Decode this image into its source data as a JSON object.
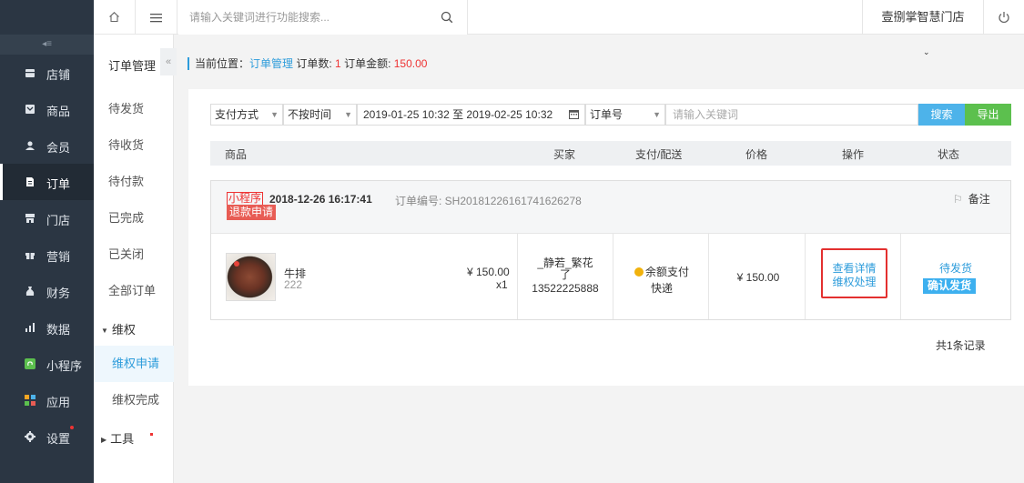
{
  "topbar": {
    "search_placeholder": "请输入关键词进行功能搜索...",
    "store_name": "壹捌掌智慧门店"
  },
  "main_nav": {
    "items": [
      {
        "label": "店铺",
        "icon": "store-icon"
      },
      {
        "label": "商品",
        "icon": "goods-icon"
      },
      {
        "label": "会员",
        "icon": "member-icon"
      },
      {
        "label": "订单",
        "icon": "order-icon",
        "active": true
      },
      {
        "label": "门店",
        "icon": "shop-icon"
      },
      {
        "label": "营销",
        "icon": "gift-icon"
      },
      {
        "label": "财务",
        "icon": "finance-icon"
      },
      {
        "label": "数据",
        "icon": "chart-icon"
      },
      {
        "label": "小程序",
        "icon": "miniprogram-icon"
      },
      {
        "label": "应用",
        "icon": "apps-icon"
      },
      {
        "label": "设置",
        "icon": "gear-icon"
      }
    ]
  },
  "sub_nav": {
    "title": "订单管理",
    "items": [
      "待发货",
      "待收货",
      "待付款",
      "已完成",
      "已关闭",
      "全部订单"
    ],
    "group_label": "维权",
    "group_items": [
      "维权申请",
      "维权完成"
    ],
    "tools_label": "工具"
  },
  "breadcrumb": {
    "prefix": "当前位置：",
    "link": "订单管理",
    "count_label": "订单数: ",
    "count": "1",
    "amount_label": "订单金额: ",
    "amount": "150.00"
  },
  "filters": {
    "pay_method": "支付方式",
    "time_filter": "不按时间",
    "date_range": "2019-01-25 10:32 至 2019-02-25 10:32",
    "field": "订单号",
    "keyword_placeholder": "请输入关键词",
    "search_label": "搜索",
    "export_label": "导出"
  },
  "table": {
    "headers": [
      "商品",
      "买家",
      "支付/配送",
      "价格",
      "操作",
      "状态"
    ]
  },
  "order": {
    "source_tag": "小程序",
    "refund_tag": "退款申请",
    "datetime": "2018-12-26  16:17:41",
    "order_no": "订单编号: SH20181226161741626278",
    "remark_label": "备注",
    "product_name": "牛排",
    "product_spec": "222",
    "unit_price": "¥ 150.00",
    "qty": "x1",
    "buyer_name": "_静若_繁花了",
    "buyer_phone": "13522225888",
    "pay_method": "余额支付",
    "delivery": "快递",
    "price": "¥ 150.00",
    "op_view": "查看详情",
    "op_rights": "维权处理",
    "status": "待发货",
    "ship_label": "确认发货"
  },
  "footer": {
    "total": "共1条记录"
  },
  "colors": {
    "nav_bg": "#2b3643",
    "accent_blue": "#2d9cdb",
    "search_btn": "#4db3ea",
    "export_btn": "#5cc04e",
    "red": "#e33"
  }
}
